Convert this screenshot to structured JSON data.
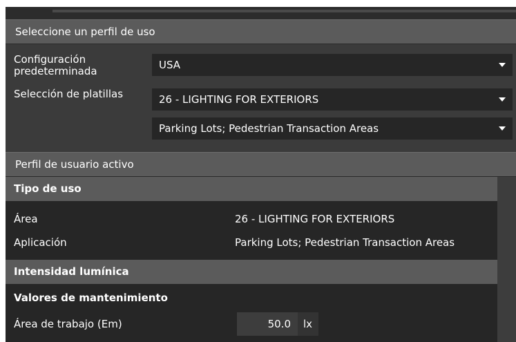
{
  "usage_profile": {
    "header": "Seleccione un perfil de uso",
    "default_config_label": "Configuración predeterminada",
    "default_config_value": "USA",
    "template_label": "Selección de platillas",
    "template_value": "26 - LIGHTING FOR EXTERIORS",
    "subtemplate_value": "Parking Lots; Pedestrian Transaction Areas"
  },
  "active_profile": {
    "header": "Perfil de usuario activo",
    "usage_type": {
      "title": "Tipo de uso",
      "area_label": "Área",
      "area_value": "26 - LIGHTING FOR EXTERIORS",
      "application_label": "Aplicación",
      "application_value": "Parking Lots; Pedestrian Transaction Areas"
    },
    "light_intensity": {
      "title": "Intensidad lumínica",
      "maintenance_title": "Valores de mantenimiento",
      "work_area_label": "Área de trabajo (Em)",
      "work_area_value": "50.0",
      "work_area_unit": "lx"
    }
  }
}
